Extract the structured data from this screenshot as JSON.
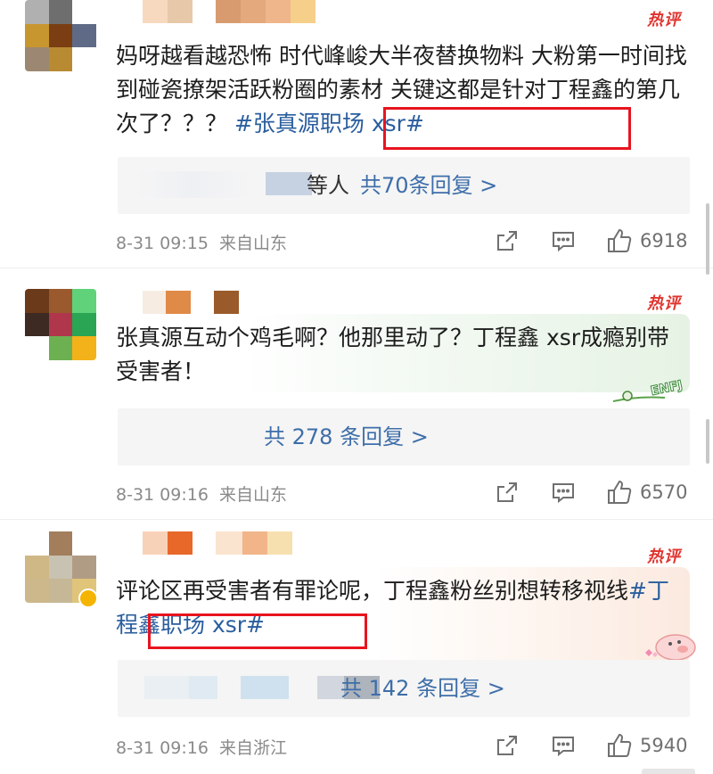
{
  "hot_label": "热评",
  "comments": [
    {
      "text_main": "妈呀越看越恐怖 时代峰峻大半夜替换物料 大粉第一时间找到碰瓷撩架活跃粉圈的素材 关键这都是针对丁程鑫的第几次了？？？",
      "topic": "#张真源职场 xsr#",
      "reply_prefix": "等人",
      "reply_label": "共70条回复 >",
      "time": "8-31 09:15",
      "source": "来自山东",
      "likes": "6918"
    },
    {
      "text_main": "张真源互动个鸡毛啊？他那里动了？丁程鑫 xsr成瘾别带受害者！",
      "topic": "",
      "reply_prefix": "",
      "reply_label": "共 278 条回复 >",
      "time": "8-31 09:16",
      "source": "来自山东",
      "likes": "6570",
      "badge_text": "ENFJ"
    },
    {
      "text_main": "评论区再受害者有罪论呢，丁程鑫粉丝别想转移视线",
      "topic": "#丁程鑫职场 xsr#",
      "reply_prefix": "",
      "reply_label": "共 142 条回复 >",
      "time": "8-31 09:16",
      "source": "来自浙江",
      "likes": "5940"
    }
  ],
  "colors": {
    "topic_link": "#2a5e9e",
    "reply_link": "#3e6ea9",
    "hot_red": "#e0342f",
    "highlight_box": "#e8141e"
  },
  "icons": [
    "share-icon",
    "comment-icon",
    "like-icon"
  ]
}
